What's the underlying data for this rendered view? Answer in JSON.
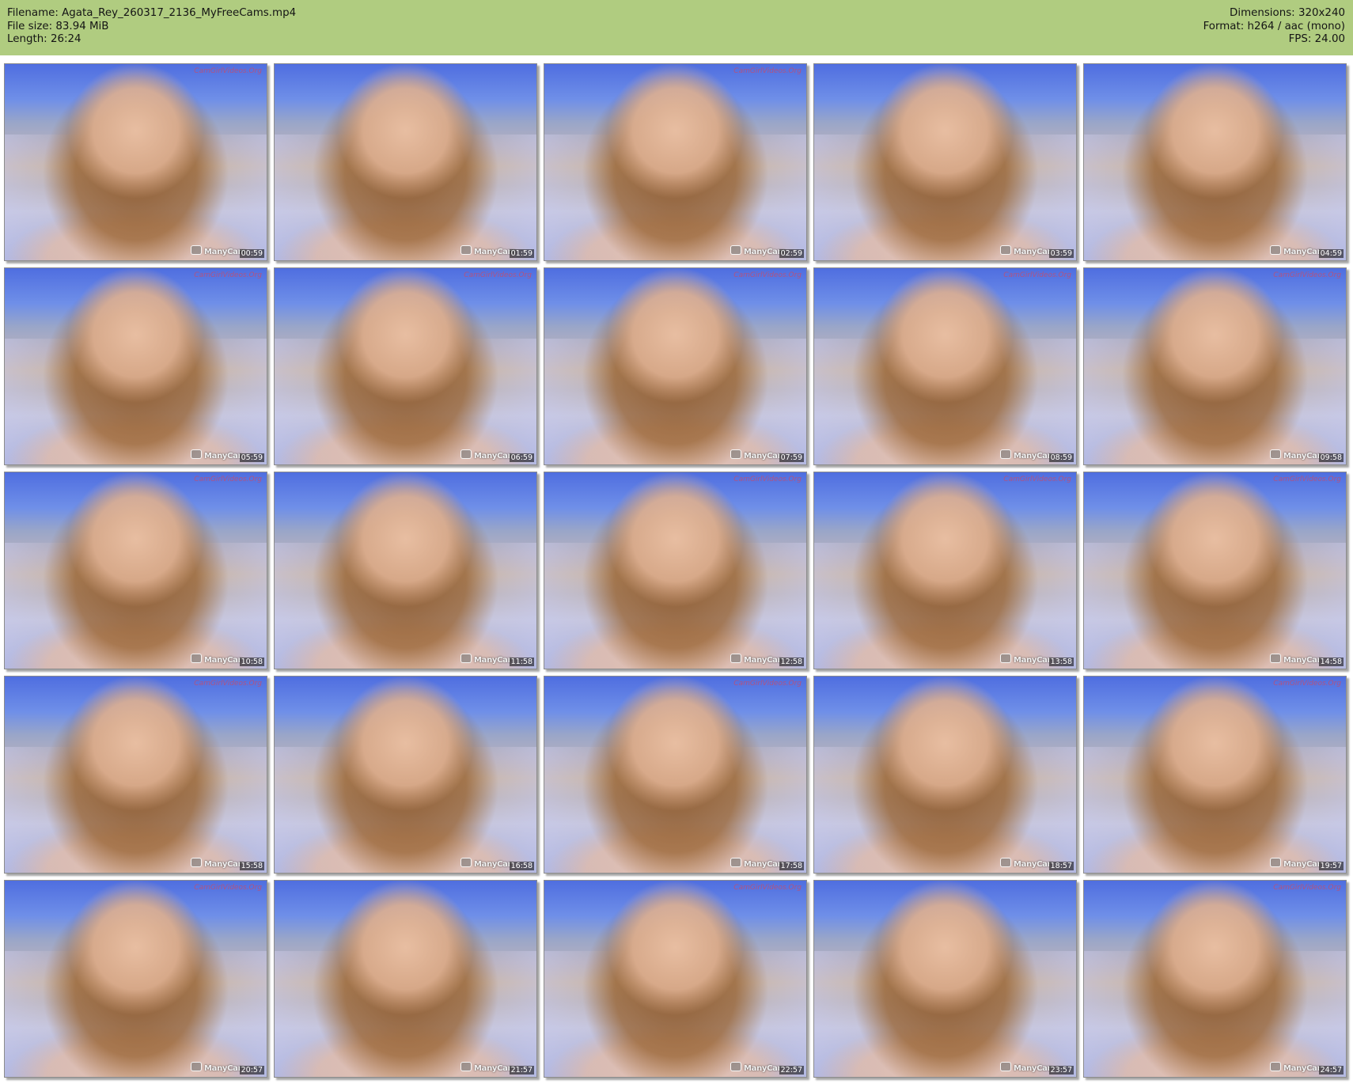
{
  "header": {
    "filename": "Filename: Agata_Rey_260317_2136_MyFreeCams.mp4",
    "filesize": "File size: 83.94 MiB",
    "length": "Length: 26:24",
    "dimensions": "Dimensions: 320x240",
    "format": "Format: h264 / aac (mono)",
    "fps": "FPS: 24.00"
  },
  "thumbnails": [
    {
      "time": "00:59",
      "watermark": "ManyCam",
      "top_watermark": "CamGirlVideos.Org"
    },
    {
      "time": "01:59",
      "watermark": "ManyCam",
      "top_watermark": ""
    },
    {
      "time": "02:59",
      "watermark": "ManyCam",
      "top_watermark": "CamGirlVideos.Org"
    },
    {
      "time": "03:59",
      "watermark": "ManyCar",
      "top_watermark": ""
    },
    {
      "time": "04:59",
      "watermark": "ManyCar",
      "top_watermark": ""
    },
    {
      "time": "05:59",
      "watermark": "ManyCar",
      "top_watermark": "CamGirlVideos.Org"
    },
    {
      "time": "06:59",
      "watermark": "ManyCar",
      "top_watermark": "CamGirlVideos.Org"
    },
    {
      "time": "07:59",
      "watermark": "ManyCar",
      "top_watermark": "CamGirlVideos.Org"
    },
    {
      "time": "08:59",
      "watermark": "ManyCar",
      "top_watermark": "CamGirlVideos.Org"
    },
    {
      "time": "09:58",
      "watermark": "ManyCar",
      "top_watermark": "CamGirlVideos.Org"
    },
    {
      "time": "10:58",
      "watermark": "ManyCar",
      "top_watermark": "CamGirlVideos.Org"
    },
    {
      "time": "11:58",
      "watermark": "ManyCar",
      "top_watermark": ""
    },
    {
      "time": "12:58",
      "watermark": "ManyCar",
      "top_watermark": "CamGirlVideos.Org"
    },
    {
      "time": "13:58",
      "watermark": "ManyCar",
      "top_watermark": "CamGirlVideos.Org"
    },
    {
      "time": "14:58",
      "watermark": "ManyCar",
      "top_watermark": "CamGirlVideos.Org"
    },
    {
      "time": "15:58",
      "watermark": "ManyCar",
      "top_watermark": "CamGirlVideos.Org"
    },
    {
      "time": "16:58",
      "watermark": "ManyCar",
      "top_watermark": ""
    },
    {
      "time": "17:58",
      "watermark": "ManyCar",
      "top_watermark": "CamGirlVideos.Org"
    },
    {
      "time": "18:57",
      "watermark": "ManyCar",
      "top_watermark": ""
    },
    {
      "time": "19:57",
      "watermark": "ManyCar",
      "top_watermark": "CamGirlVideos.Org"
    },
    {
      "time": "20:57",
      "watermark": "ManyCar",
      "top_watermark": "CamGirlVideos.Org"
    },
    {
      "time": "21:57",
      "watermark": "ManyCar",
      "top_watermark": ""
    },
    {
      "time": "22:57",
      "watermark": "ManyCar",
      "top_watermark": "CamGirlVideos.Org"
    },
    {
      "time": "23:57",
      "watermark": "ManyCar",
      "top_watermark": ""
    },
    {
      "time": "24:57",
      "watermark": "ManyCar",
      "top_watermark": "CamGirlVideos.Org"
    }
  ],
  "colors": {
    "header_bg": "#b0cc80",
    "page_bg": "#ffffff",
    "timestamp_text": "#ffffff"
  }
}
